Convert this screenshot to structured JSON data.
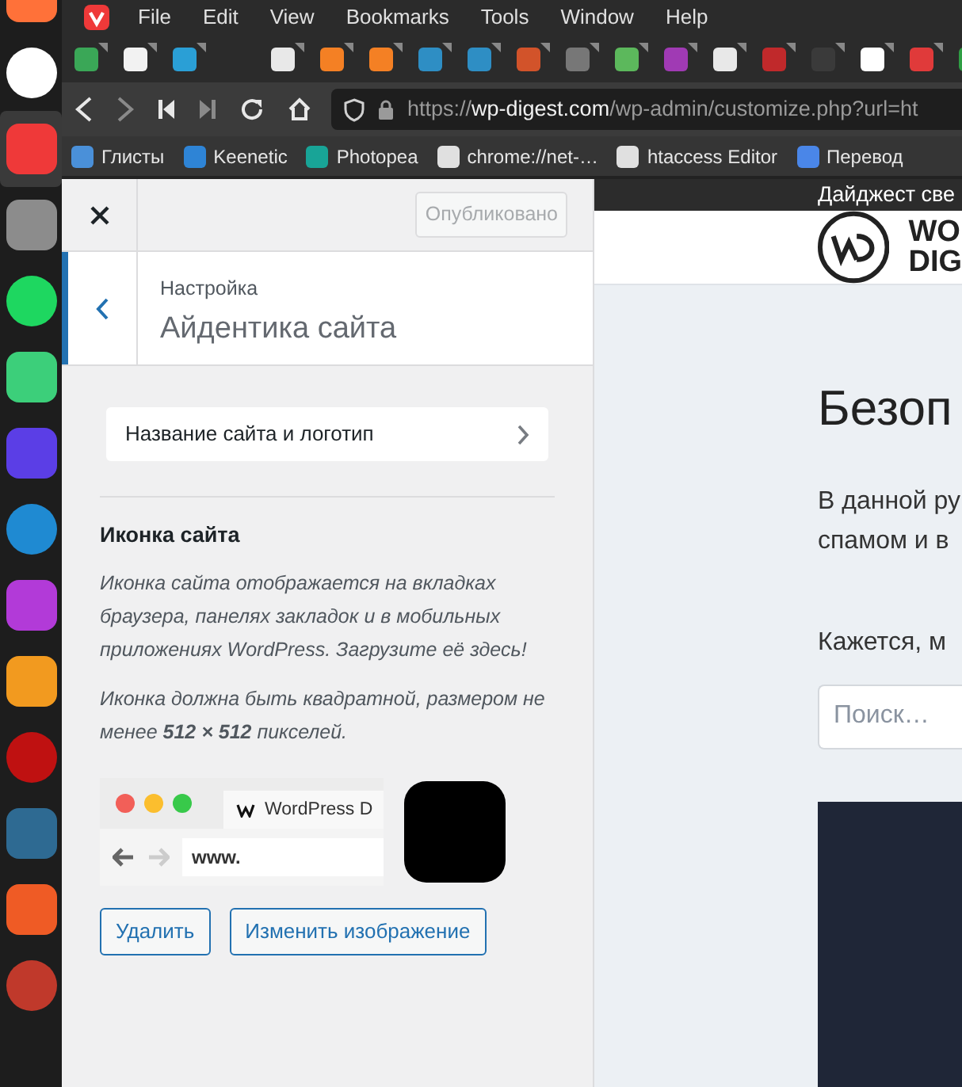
{
  "dock": [
    {
      "color": "#ff7139",
      "selected": false
    },
    {
      "color": "#ffffff",
      "selected": false
    },
    {
      "color": "#ef3939",
      "selected": true
    },
    {
      "color": "#8c8c8c",
      "selected": false
    },
    {
      "color": "#1ed760",
      "selected": false
    },
    {
      "color": "#3ccf7a",
      "selected": false
    },
    {
      "color": "#5b3ee6",
      "selected": false
    },
    {
      "color": "#1f8ad2",
      "selected": false
    },
    {
      "color": "#b23ad8",
      "selected": false
    },
    {
      "color": "#f29a1f",
      "selected": false
    },
    {
      "color": "#bf1111",
      "selected": false
    },
    {
      "color": "#2e6a92",
      "selected": false
    },
    {
      "color": "#ef5b25",
      "selected": false
    },
    {
      "color": "#c0392b",
      "selected": false
    }
  ],
  "menu": {
    "items": [
      "File",
      "Edit",
      "View",
      "Bookmarks",
      "Tools",
      "Window",
      "Help"
    ]
  },
  "tabs": [
    {
      "color": "#3aa757"
    },
    {
      "color": "#f2f2f2"
    },
    {
      "color": "#2a9fd6"
    },
    {
      "color": "#e8e8e8"
    },
    {
      "color": "#f48024"
    },
    {
      "color": "#f48024"
    },
    {
      "color": "#2e8ec4"
    },
    {
      "color": "#2e8ec4"
    },
    {
      "color": "#d2532a"
    },
    {
      "color": "#777777"
    },
    {
      "color": "#5cb85c"
    },
    {
      "color": "#a03ab4"
    },
    {
      "color": "#e8e8e8"
    },
    {
      "color": "#c0292b"
    },
    {
      "color": "#3a3a3a"
    },
    {
      "color": "#ffffff"
    },
    {
      "color": "#e03a3a"
    },
    {
      "color": "#2f9e44"
    }
  ],
  "address_bar": {
    "scheme": "https://",
    "host": "wp-digest.com",
    "path": "/wp-admin/customize.php?url=ht"
  },
  "bookmarks": [
    {
      "label": "Глисты",
      "color": "#4a90d9"
    },
    {
      "label": "Keenetic",
      "color": "#2e84d6"
    },
    {
      "label": "Photopea",
      "color": "#18a497"
    },
    {
      "label": "chrome://net-…",
      "color": "#e0e0e0"
    },
    {
      "label": "htaccess Editor",
      "color": "#e0e0e0"
    },
    {
      "label": "Перевод",
      "color": "#4a86e8"
    }
  ],
  "customizer": {
    "publish_button": {
      "label": "Опубликовано",
      "disabled": true
    },
    "breadcrumb": "Настройка",
    "title": "Айдентика сайта",
    "section_link": "Название сайта и логотип",
    "site_icon": {
      "heading": "Иконка сайта",
      "description": "Иконка сайта отображается на вкладках браузера, панелях закладок и в мобильных приложениях WordPress. Загрузите её здесь!",
      "requirement": "Иконка должна быть квадратной, размером не менее **512 × 512** пикселей.",
      "preview_tab": "WordPress D",
      "preview_url": "www.",
      "buttons": [
        "Удалить",
        "Изменить изображение"
      ]
    }
  },
  "site_preview": {
    "admin_bar": "Дайджест све",
    "logo_lines": [
      "WO",
      "DIG"
    ],
    "heading": "Безоп",
    "paragraph_lines": [
      "В данной ру",
      "спамом и в"
    ],
    "notice": "Кажется, м",
    "search": {
      "placeholder": "Поиск…"
    }
  }
}
